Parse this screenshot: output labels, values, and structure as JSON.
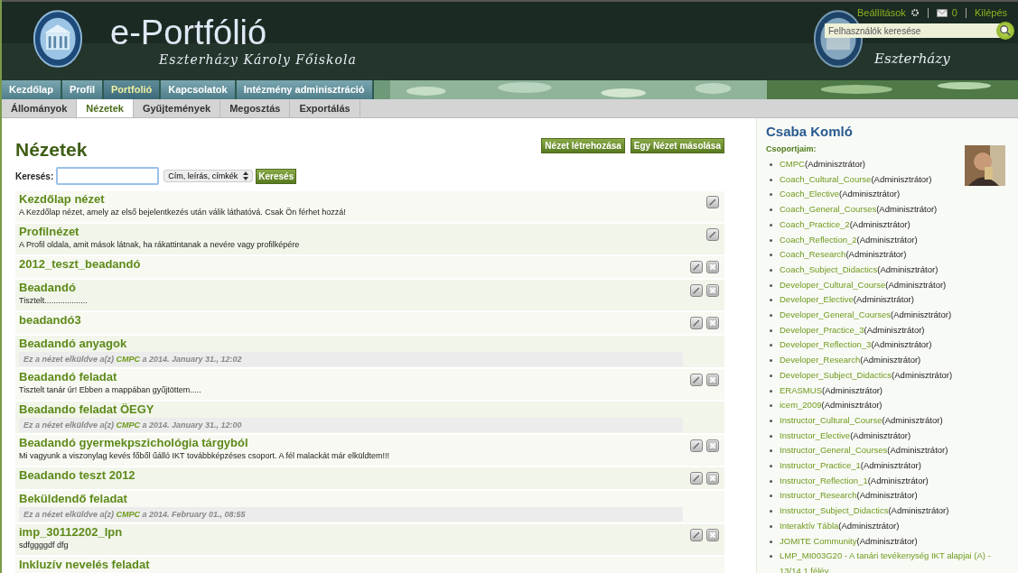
{
  "header": {
    "title": "e-Portfólió",
    "subtitle": "Eszterházy Károly Főiskola",
    "banner_subtitle_repeat": "Eszterházy",
    "user_links": {
      "settings": "Beállítások",
      "messages": "0",
      "logout": "Kilépés"
    },
    "user_search": {
      "placeholder": "Felhasználók keresése"
    }
  },
  "main_nav": [
    {
      "label": "Kezdőlap",
      "selected": false
    },
    {
      "label": "Profil",
      "selected": false
    },
    {
      "label": "Portfolió",
      "selected": true
    },
    {
      "label": "Kapcsolatok",
      "selected": false
    },
    {
      "label": "Intézmény adminisztráció",
      "selected": false
    }
  ],
  "sub_nav": [
    {
      "label": "Állományok",
      "selected": false
    },
    {
      "label": "Nézetek",
      "selected": true
    },
    {
      "label": "Gyűjtemények",
      "selected": false
    },
    {
      "label": "Megosztás",
      "selected": false
    },
    {
      "label": "Exportálás",
      "selected": false
    }
  ],
  "page": {
    "title": "Nézetek",
    "buttons": [
      "Nézet létrehozása",
      "Egy Nézet másolása"
    ],
    "search": {
      "label": "Keresés:",
      "scope": "Cím, leírás, címkék",
      "button": "Keresés"
    }
  },
  "views": [
    {
      "title": "Kezdőlap nézet",
      "description": "A Kezdőlap nézet, amely az első bejelentkezés után válik láthatóvá. Csak Ön férhet hozzá!",
      "editable": true,
      "deletable": false
    },
    {
      "title": "Profilnézet",
      "description": "A Profil oldala, amit mások látnak, ha rákattintanak a nevére vagy profilképére",
      "editable": true,
      "deletable": false
    },
    {
      "title": "2012_teszt_beadandó",
      "editable": true,
      "deletable": true
    },
    {
      "title": "Beadandó",
      "description": "Tisztelt...................",
      "editable": true,
      "deletable": true
    },
    {
      "title": "beadandó3",
      "editable": true,
      "deletable": true
    },
    {
      "title": "Beadandó anyagok",
      "submitted": {
        "prefix": "Ez a nézet elküldve a(z)",
        "group": "CMPC",
        "suffix": "a 2014. January 31., 12:02"
      },
      "editable": false,
      "deletable": false
    },
    {
      "title": "Beadandó feladat",
      "description": "Tisztelt tanár úr! Ebben a mappában gyűjtöttem.....",
      "editable": true,
      "deletable": true
    },
    {
      "title": "Beadando feladat ÖEGY",
      "submitted": {
        "prefix": "Ez a nézet elküldve a(z)",
        "group": "CMPC",
        "suffix": "a 2014. January 31., 12:00"
      },
      "editable": false,
      "deletable": false
    },
    {
      "title": "Beadandó gyermekpszichológia tárgyból",
      "description": "Mi vagyunk a viszonylag kevés főből űálló IKT továbbképzéses csoport. A fél malackát már elküldtem!!!",
      "editable": true,
      "deletable": true
    },
    {
      "title": "Beadando teszt 2012",
      "editable": true,
      "deletable": true
    },
    {
      "title": "Beküldendő feladat",
      "submitted": {
        "prefix": "Ez a nézet elküldve a(z)",
        "group": "CMPC",
        "suffix": "a 2014. February 01., 08:55"
      },
      "editable": false,
      "deletable": false
    },
    {
      "title": "imp_30112202_lpn",
      "description": "sdfggggdf  dfg",
      "editable": true,
      "deletable": true
    },
    {
      "title": "Inkluzív nevelés feladat",
      "editable": false,
      "deletable": false
    }
  ],
  "sidebar": {
    "user_name": "Csaba Komló",
    "groups_heading": "Csoportjaim:",
    "groups": [
      {
        "name": "CMPC",
        "role": "(Adminisztrátor)"
      },
      {
        "name": "Coach_Cultural_Course",
        "role": "(Adminisztrátor)"
      },
      {
        "name": "Coach_Elective",
        "role": "(Adminisztrátor)"
      },
      {
        "name": "Coach_General_Courses",
        "role": "(Adminisztrátor)"
      },
      {
        "name": "Coach_Practice_2",
        "role": "(Adminisztrátor)"
      },
      {
        "name": "Coach_Reflection_2",
        "role": "(Adminisztrátor)"
      },
      {
        "name": "Coach_Research",
        "role": "(Adminisztrátor)"
      },
      {
        "name": "Coach_Subject_Didactics",
        "role": "(Adminisztrátor)"
      },
      {
        "name": "Developer_Cultural_Course",
        "role": "(Adminisztrátor)"
      },
      {
        "name": "Developer_Elective",
        "role": "(Adminisztrátor)"
      },
      {
        "name": "Developer_General_Courses",
        "role": "(Adminisztrátor)"
      },
      {
        "name": "Developer_Practice_3",
        "role": "(Adminisztrátor)"
      },
      {
        "name": "Developer_Reflection_3",
        "role": "(Adminisztrátor)"
      },
      {
        "name": "Developer_Research",
        "role": "(Adminisztrátor)"
      },
      {
        "name": "Developer_Subject_Didactics",
        "role": "(Adminisztrátor)"
      },
      {
        "name": "ERASMUS",
        "role": "(Adminisztrátor)"
      },
      {
        "name": "icem_2009",
        "role": "(Adminisztrátor)"
      },
      {
        "name": "Instructor_Cultural_Course",
        "role": "(Adminisztrátor)"
      },
      {
        "name": "Instructor_Elective",
        "role": "(Adminisztrátor)"
      },
      {
        "name": "Instructor_General_Courses",
        "role": "(Adminisztrátor)"
      },
      {
        "name": "Instructor_Practice_1",
        "role": "(Adminisztrátor)"
      },
      {
        "name": "Instructor_Reflection_1",
        "role": "(Adminisztrátor)"
      },
      {
        "name": "Instructor_Research",
        "role": "(Adminisztrátor)"
      },
      {
        "name": "Instructor_Subject_Didactics",
        "role": "(Adminisztrátor)"
      },
      {
        "name": "Interaktív Tábla",
        "role": "(Adminisztrátor)"
      },
      {
        "name": "JOMITE Community",
        "role": "(Adminisztrátor)"
      },
      {
        "name": "LMP_MI003G20 - A tanári tevékenység IKT alapjai (A) - 13/14 1.félév"
      }
    ]
  }
}
